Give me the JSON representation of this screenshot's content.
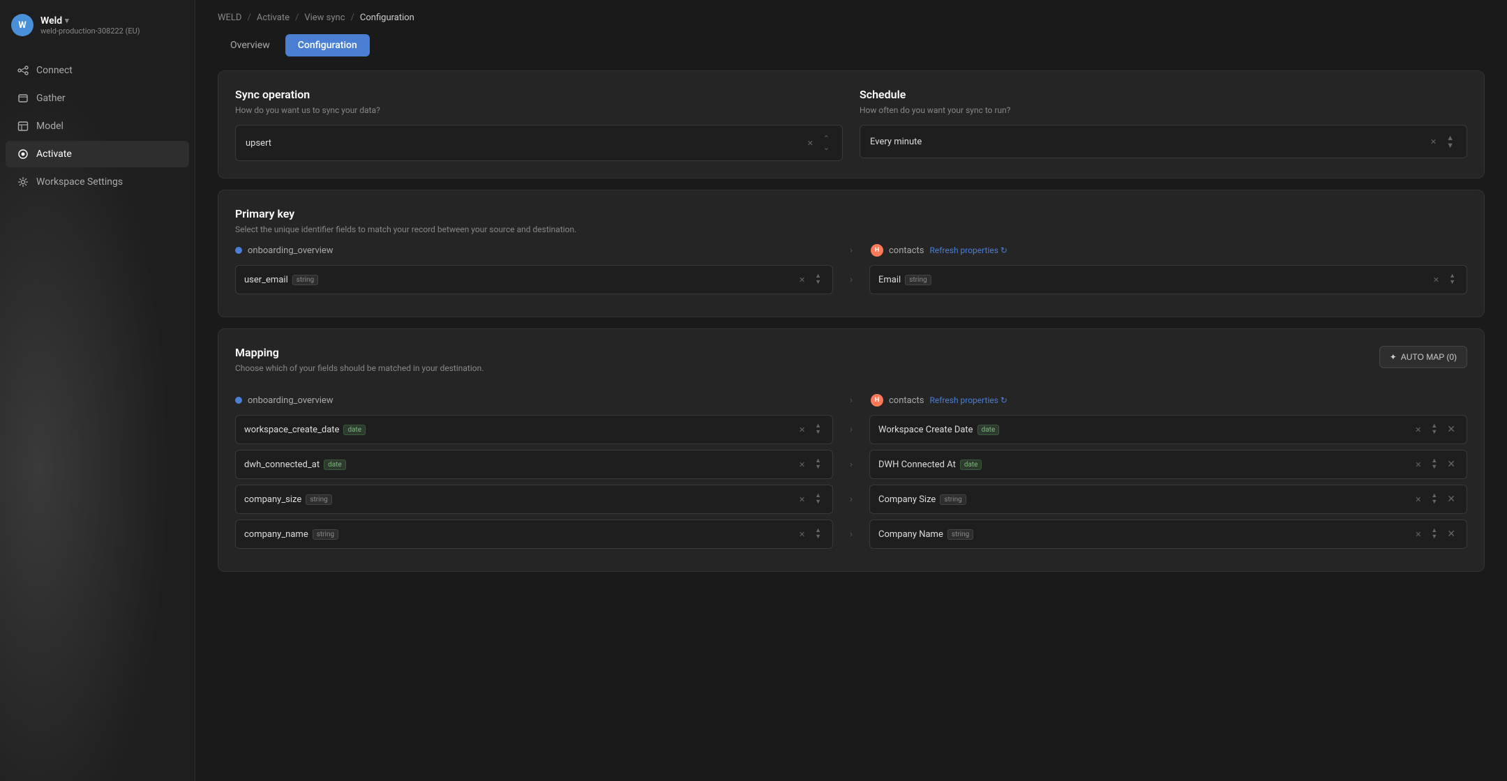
{
  "sidebar": {
    "workspace": {
      "avatar": "W",
      "name": "Weld",
      "chevron": "▾",
      "sub": "weld-production-308222 (EU)"
    },
    "nav": [
      {
        "id": "connect",
        "label": "Connect",
        "icon": "connect"
      },
      {
        "id": "gather",
        "label": "Gather",
        "icon": "gather"
      },
      {
        "id": "model",
        "label": "Model",
        "icon": "model"
      },
      {
        "id": "activate",
        "label": "Activate",
        "icon": "activate",
        "active": true
      },
      {
        "id": "workspace-settings",
        "label": "Workspace Settings",
        "icon": "settings"
      }
    ]
  },
  "breadcrumb": {
    "weld": "WELD",
    "activate": "Activate",
    "view_sync": "View sync",
    "configuration": "Configuration"
  },
  "tabs": [
    {
      "id": "overview",
      "label": "Overview",
      "active": false
    },
    {
      "id": "configuration",
      "label": "Configuration",
      "active": true
    }
  ],
  "sync_operation": {
    "title": "Sync operation",
    "subtitle": "How do you want us to sync your data?",
    "value": "upsert"
  },
  "schedule": {
    "title": "Schedule",
    "subtitle": "How often do you want your sync to run?",
    "value": "Every minute"
  },
  "primary_key": {
    "title": "Primary key",
    "subtitle": "Select the unique identifier fields to match your record between your source and destination.",
    "source": "onboarding_overview",
    "destination": "contacts",
    "refresh_label": "Refresh properties",
    "field_source": {
      "name": "user_email",
      "type": "string"
    },
    "field_dest": {
      "name": "Email",
      "type": "string"
    }
  },
  "mapping": {
    "title": "Mapping",
    "subtitle": "Choose which of your fields should be matched in your destination.",
    "auto_map_label": "AUTO MAP (0)",
    "source": "onboarding_overview",
    "destination": "contacts",
    "refresh_label": "Refresh properties",
    "rows": [
      {
        "src_name": "workspace_create_date",
        "src_type": "date",
        "src_type_class": "date",
        "dest_name": "Workspace Create Date",
        "dest_type": "date",
        "dest_type_class": "date"
      },
      {
        "src_name": "dwh_connected_at",
        "src_type": "date",
        "src_type_class": "date",
        "dest_name": "DWH Connected At",
        "dest_type": "date",
        "dest_type_class": "date"
      },
      {
        "src_name": "company_size",
        "src_type": "string",
        "src_type_class": "string",
        "dest_name": "Company Size",
        "dest_type": "string",
        "dest_type_class": "string"
      },
      {
        "src_name": "company_name",
        "src_type": "string",
        "src_type_class": "string",
        "dest_name": "Company Name",
        "dest_type": "string",
        "dest_type_class": "string"
      }
    ]
  }
}
